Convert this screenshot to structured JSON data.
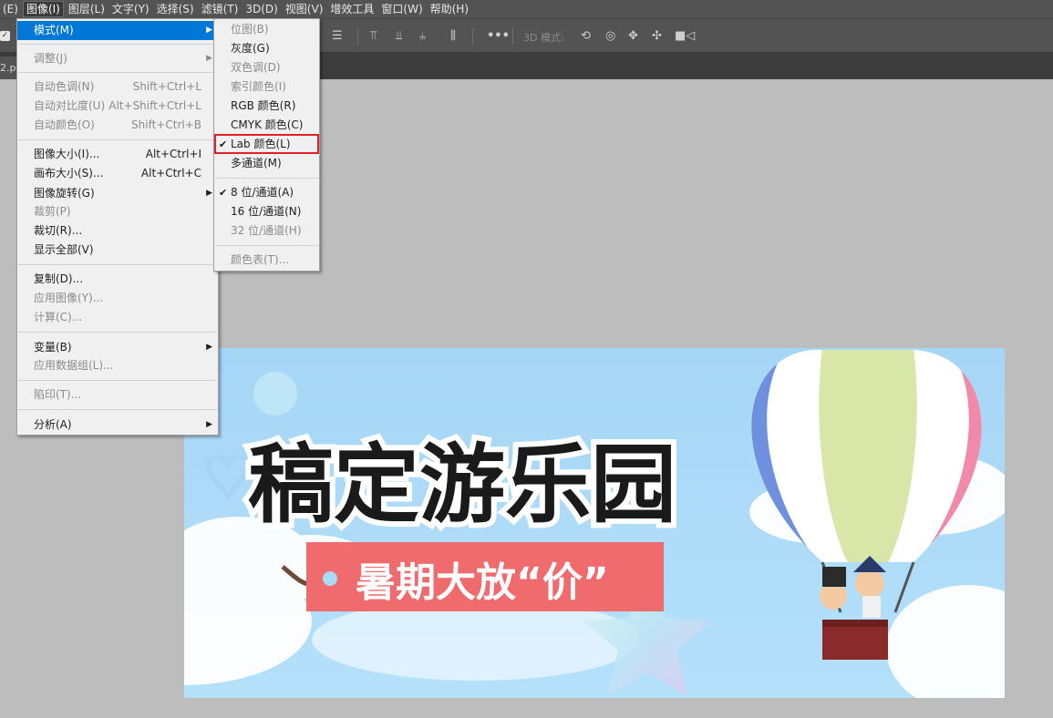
{
  "menubar": {
    "items": [
      {
        "label": "(E)",
        "active": false
      },
      {
        "label": "图像(I)",
        "active": true
      },
      {
        "label": "图层(L)",
        "active": false
      },
      {
        "label": "文字(Y)",
        "active": false
      },
      {
        "label": "选择(S)",
        "active": false
      },
      {
        "label": "滤镜(T)",
        "active": false
      },
      {
        "label": "3D(D)",
        "active": false
      },
      {
        "label": "视图(V)",
        "active": false
      },
      {
        "label": "增效工具",
        "active": false
      },
      {
        "label": "窗口(W)",
        "active": false
      },
      {
        "label": "帮助(H)",
        "active": false
      }
    ]
  },
  "options_bar": {
    "checkbox_checked": true,
    "label_3d": "3D 模式:",
    "icons": [
      "align-icon",
      "align-top-icon",
      "align-middle-icon",
      "align-bottom-icon",
      "distribute-icon",
      "more-icon",
      "orbit-icon",
      "roll-icon",
      "pan-icon",
      "slide-icon",
      "camera-icon"
    ]
  },
  "document_tab": {
    "label": "2.ps"
  },
  "image_menu": {
    "items": [
      {
        "label": "模式(M)",
        "shortcut": "",
        "submenu": true,
        "disabled": false,
        "highlighted": true
      },
      {
        "label": "调整(J)",
        "shortcut": "",
        "submenu": true,
        "disabled": true
      },
      {
        "label": "自动色调(N)",
        "shortcut": "Shift+Ctrl+L",
        "submenu": false,
        "disabled": true
      },
      {
        "label": "自动对比度(U)",
        "shortcut": "Alt+Shift+Ctrl+L",
        "submenu": false,
        "disabled": true
      },
      {
        "label": "自动颜色(O)",
        "shortcut": "Shift+Ctrl+B",
        "submenu": false,
        "disabled": true
      },
      {
        "label": "图像大小(I)...",
        "shortcut": "Alt+Ctrl+I",
        "submenu": false,
        "disabled": false
      },
      {
        "label": "画布大小(S)...",
        "shortcut": "Alt+Ctrl+C",
        "submenu": false,
        "disabled": false
      },
      {
        "label": "图像旋转(G)",
        "shortcut": "",
        "submenu": true,
        "disabled": false
      },
      {
        "label": "裁剪(P)",
        "shortcut": "",
        "submenu": false,
        "disabled": true
      },
      {
        "label": "裁切(R)...",
        "shortcut": "",
        "submenu": false,
        "disabled": false
      },
      {
        "label": "显示全部(V)",
        "shortcut": "",
        "submenu": false,
        "disabled": false
      },
      {
        "label": "复制(D)...",
        "shortcut": "",
        "submenu": false,
        "disabled": false
      },
      {
        "label": "应用图像(Y)...",
        "shortcut": "",
        "submenu": false,
        "disabled": true
      },
      {
        "label": "计算(C)...",
        "shortcut": "",
        "submenu": false,
        "disabled": true
      },
      {
        "label": "变量(B)",
        "shortcut": "",
        "submenu": true,
        "disabled": false
      },
      {
        "label": "应用数据组(L)...",
        "shortcut": "",
        "submenu": false,
        "disabled": true
      },
      {
        "label": "陷印(T)...",
        "shortcut": "",
        "submenu": false,
        "disabled": true
      },
      {
        "label": "分析(A)",
        "shortcut": "",
        "submenu": true,
        "disabled": false
      }
    ]
  },
  "mode_submenu": {
    "items": [
      {
        "label": "位图(B)",
        "checked": false,
        "disabled": true
      },
      {
        "label": "灰度(G)",
        "checked": false,
        "disabled": false
      },
      {
        "label": "双色调(D)",
        "checked": false,
        "disabled": true
      },
      {
        "label": "索引颜色(I)",
        "checked": false,
        "disabled": true
      },
      {
        "label": "RGB 颜色(R)",
        "checked": false,
        "disabled": false
      },
      {
        "label": "CMYK 颜色(C)",
        "checked": false,
        "disabled": false
      },
      {
        "label": "Lab 颜色(L)",
        "checked": true,
        "disabled": false,
        "annotated": true
      },
      {
        "label": "多通道(M)",
        "checked": false,
        "disabled": false
      },
      {
        "label": "8 位/通道(A)",
        "checked": true,
        "disabled": false
      },
      {
        "label": "16 位/通道(N)",
        "checked": false,
        "disabled": false
      },
      {
        "label": "32 位/通道(H)",
        "checked": false,
        "disabled": true
      },
      {
        "label": "颜色表(T)...",
        "checked": false,
        "disabled": true
      }
    ],
    "annotation_color": "#e0202a"
  },
  "canvas": {
    "title": "稿定游乐园",
    "subtitle": "暑期大放“价”",
    "colors": {
      "sky": "#a9daf8",
      "title_fill": "#1a1a1a",
      "title_stroke": "#ffffff",
      "banner": "#f06b6e",
      "basket": "#8b2a2a"
    }
  }
}
